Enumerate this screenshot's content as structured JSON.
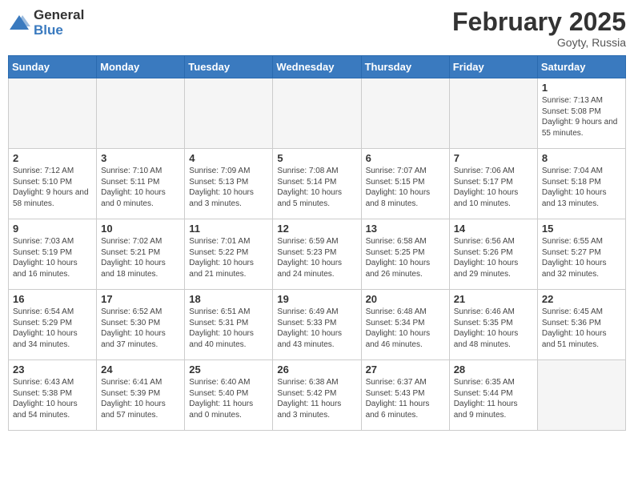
{
  "header": {
    "logo_general": "General",
    "logo_blue": "Blue",
    "month_title": "February 2025",
    "location": "Goyty, Russia"
  },
  "weekdays": [
    "Sunday",
    "Monday",
    "Tuesday",
    "Wednesday",
    "Thursday",
    "Friday",
    "Saturday"
  ],
  "weeks": [
    [
      {
        "day": "",
        "info": ""
      },
      {
        "day": "",
        "info": ""
      },
      {
        "day": "",
        "info": ""
      },
      {
        "day": "",
        "info": ""
      },
      {
        "day": "",
        "info": ""
      },
      {
        "day": "",
        "info": ""
      },
      {
        "day": "1",
        "info": "Sunrise: 7:13 AM\nSunset: 5:08 PM\nDaylight: 9 hours and 55 minutes."
      }
    ],
    [
      {
        "day": "2",
        "info": "Sunrise: 7:12 AM\nSunset: 5:10 PM\nDaylight: 9 hours and 58 minutes."
      },
      {
        "day": "3",
        "info": "Sunrise: 7:10 AM\nSunset: 5:11 PM\nDaylight: 10 hours and 0 minutes."
      },
      {
        "day": "4",
        "info": "Sunrise: 7:09 AM\nSunset: 5:13 PM\nDaylight: 10 hours and 3 minutes."
      },
      {
        "day": "5",
        "info": "Sunrise: 7:08 AM\nSunset: 5:14 PM\nDaylight: 10 hours and 5 minutes."
      },
      {
        "day": "6",
        "info": "Sunrise: 7:07 AM\nSunset: 5:15 PM\nDaylight: 10 hours and 8 minutes."
      },
      {
        "day": "7",
        "info": "Sunrise: 7:06 AM\nSunset: 5:17 PM\nDaylight: 10 hours and 10 minutes."
      },
      {
        "day": "8",
        "info": "Sunrise: 7:04 AM\nSunset: 5:18 PM\nDaylight: 10 hours and 13 minutes."
      }
    ],
    [
      {
        "day": "9",
        "info": "Sunrise: 7:03 AM\nSunset: 5:19 PM\nDaylight: 10 hours and 16 minutes."
      },
      {
        "day": "10",
        "info": "Sunrise: 7:02 AM\nSunset: 5:21 PM\nDaylight: 10 hours and 18 minutes."
      },
      {
        "day": "11",
        "info": "Sunrise: 7:01 AM\nSunset: 5:22 PM\nDaylight: 10 hours and 21 minutes."
      },
      {
        "day": "12",
        "info": "Sunrise: 6:59 AM\nSunset: 5:23 PM\nDaylight: 10 hours and 24 minutes."
      },
      {
        "day": "13",
        "info": "Sunrise: 6:58 AM\nSunset: 5:25 PM\nDaylight: 10 hours and 26 minutes."
      },
      {
        "day": "14",
        "info": "Sunrise: 6:56 AM\nSunset: 5:26 PM\nDaylight: 10 hours and 29 minutes."
      },
      {
        "day": "15",
        "info": "Sunrise: 6:55 AM\nSunset: 5:27 PM\nDaylight: 10 hours and 32 minutes."
      }
    ],
    [
      {
        "day": "16",
        "info": "Sunrise: 6:54 AM\nSunset: 5:29 PM\nDaylight: 10 hours and 34 minutes."
      },
      {
        "day": "17",
        "info": "Sunrise: 6:52 AM\nSunset: 5:30 PM\nDaylight: 10 hours and 37 minutes."
      },
      {
        "day": "18",
        "info": "Sunrise: 6:51 AM\nSunset: 5:31 PM\nDaylight: 10 hours and 40 minutes."
      },
      {
        "day": "19",
        "info": "Sunrise: 6:49 AM\nSunset: 5:33 PM\nDaylight: 10 hours and 43 minutes."
      },
      {
        "day": "20",
        "info": "Sunrise: 6:48 AM\nSunset: 5:34 PM\nDaylight: 10 hours and 46 minutes."
      },
      {
        "day": "21",
        "info": "Sunrise: 6:46 AM\nSunset: 5:35 PM\nDaylight: 10 hours and 48 minutes."
      },
      {
        "day": "22",
        "info": "Sunrise: 6:45 AM\nSunset: 5:36 PM\nDaylight: 10 hours and 51 minutes."
      }
    ],
    [
      {
        "day": "23",
        "info": "Sunrise: 6:43 AM\nSunset: 5:38 PM\nDaylight: 10 hours and 54 minutes."
      },
      {
        "day": "24",
        "info": "Sunrise: 6:41 AM\nSunset: 5:39 PM\nDaylight: 10 hours and 57 minutes."
      },
      {
        "day": "25",
        "info": "Sunrise: 6:40 AM\nSunset: 5:40 PM\nDaylight: 11 hours and 0 minutes."
      },
      {
        "day": "26",
        "info": "Sunrise: 6:38 AM\nSunset: 5:42 PM\nDaylight: 11 hours and 3 minutes."
      },
      {
        "day": "27",
        "info": "Sunrise: 6:37 AM\nSunset: 5:43 PM\nDaylight: 11 hours and 6 minutes."
      },
      {
        "day": "28",
        "info": "Sunrise: 6:35 AM\nSunset: 5:44 PM\nDaylight: 11 hours and 9 minutes."
      },
      {
        "day": "",
        "info": ""
      }
    ]
  ]
}
